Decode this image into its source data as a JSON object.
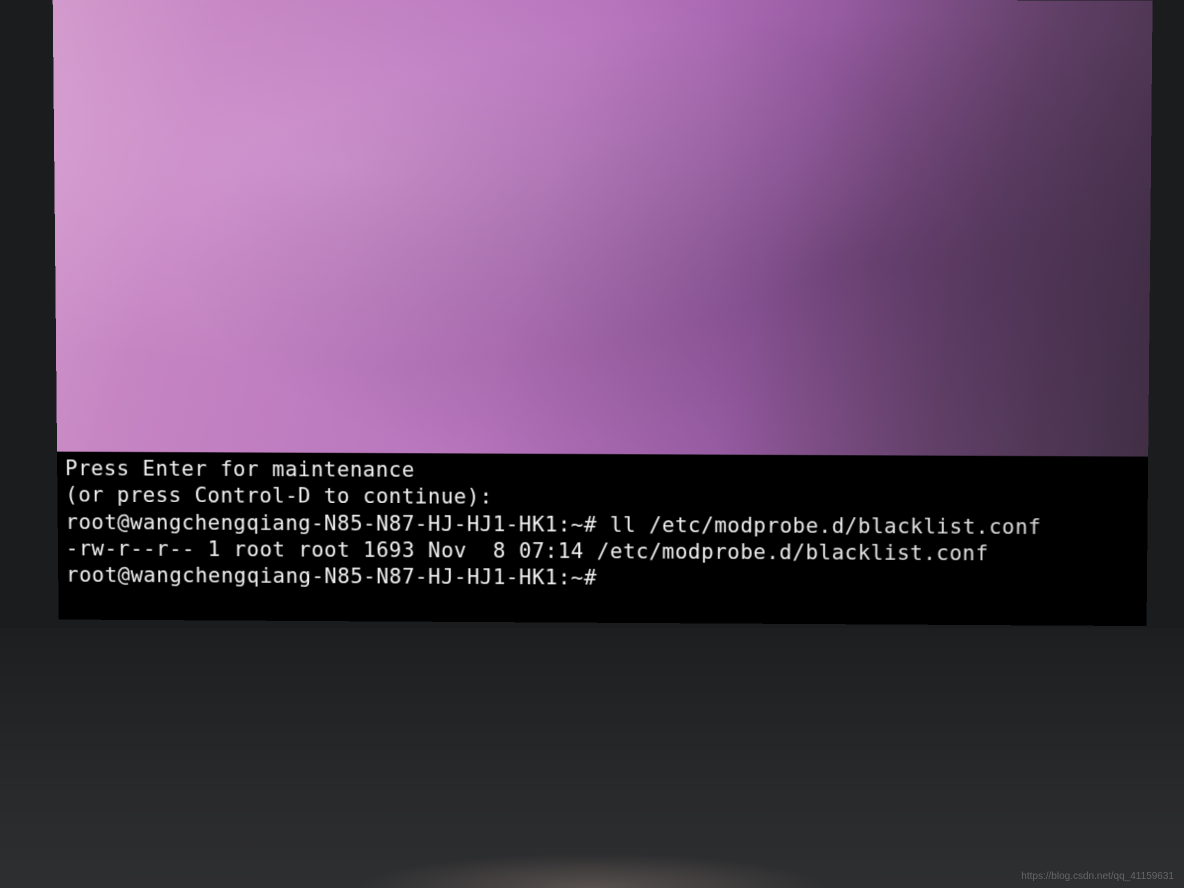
{
  "terminal": {
    "line1": "Press Enter for maintenance",
    "line2": "(or press Control-D to continue):",
    "prompt1": "root@wangchengqiang-N85-N87-HJ-HJ1-HK1:~# ",
    "command1": "ll /etc/modprobe.d/blacklist.conf",
    "output1": "-rw-r--r-- 1 root root 1693 Nov  8 07:14 /etc/modprobe.d/blacklist.conf",
    "prompt2": "root@wangchengqiang-N85-N87-HJ-HJ1-HK1:~# "
  },
  "watermark": "https://blog.csdn.net/qq_41159631"
}
